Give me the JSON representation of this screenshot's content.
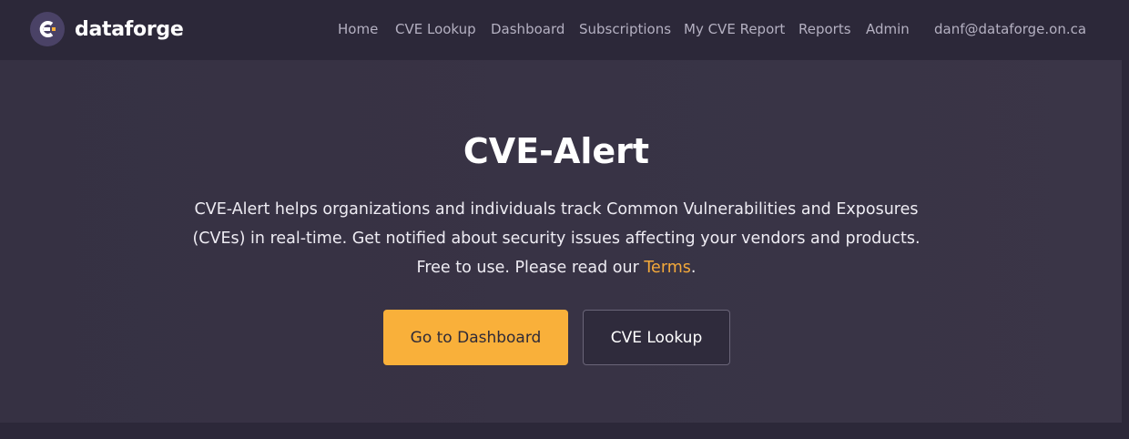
{
  "brand": {
    "name": "dataforge",
    "logo_icon": "dataforge-logo-icon"
  },
  "nav": {
    "items": [
      {
        "label": "Home"
      },
      {
        "label": "CVE Lookup"
      },
      {
        "label": "Dashboard"
      },
      {
        "label": "Subscriptions"
      },
      {
        "label": "My CVE Report"
      },
      {
        "label": "Reports"
      },
      {
        "label": "Admin"
      }
    ],
    "user_email": "danf@dataforge.on.ca"
  },
  "hero": {
    "title": "CVE-Alert",
    "text_line1": "CVE-Alert helps organizations and individuals track Common Vulnerabilities and Exposures",
    "text_line2": "(CVEs) in real-time. Get notified about security issues affecting your vendors and products.",
    "text_line3_prefix": "Free to use. Please read our ",
    "terms_label": "Terms",
    "text_line3_suffix": ".",
    "primary_button_label": "Go to Dashboard",
    "secondary_button_label": "CVE Lookup"
  },
  "colors": {
    "background": "#2c2839",
    "hero_background": "#383344",
    "accent": "#f9b03a",
    "link_accent": "#f4a93a"
  }
}
